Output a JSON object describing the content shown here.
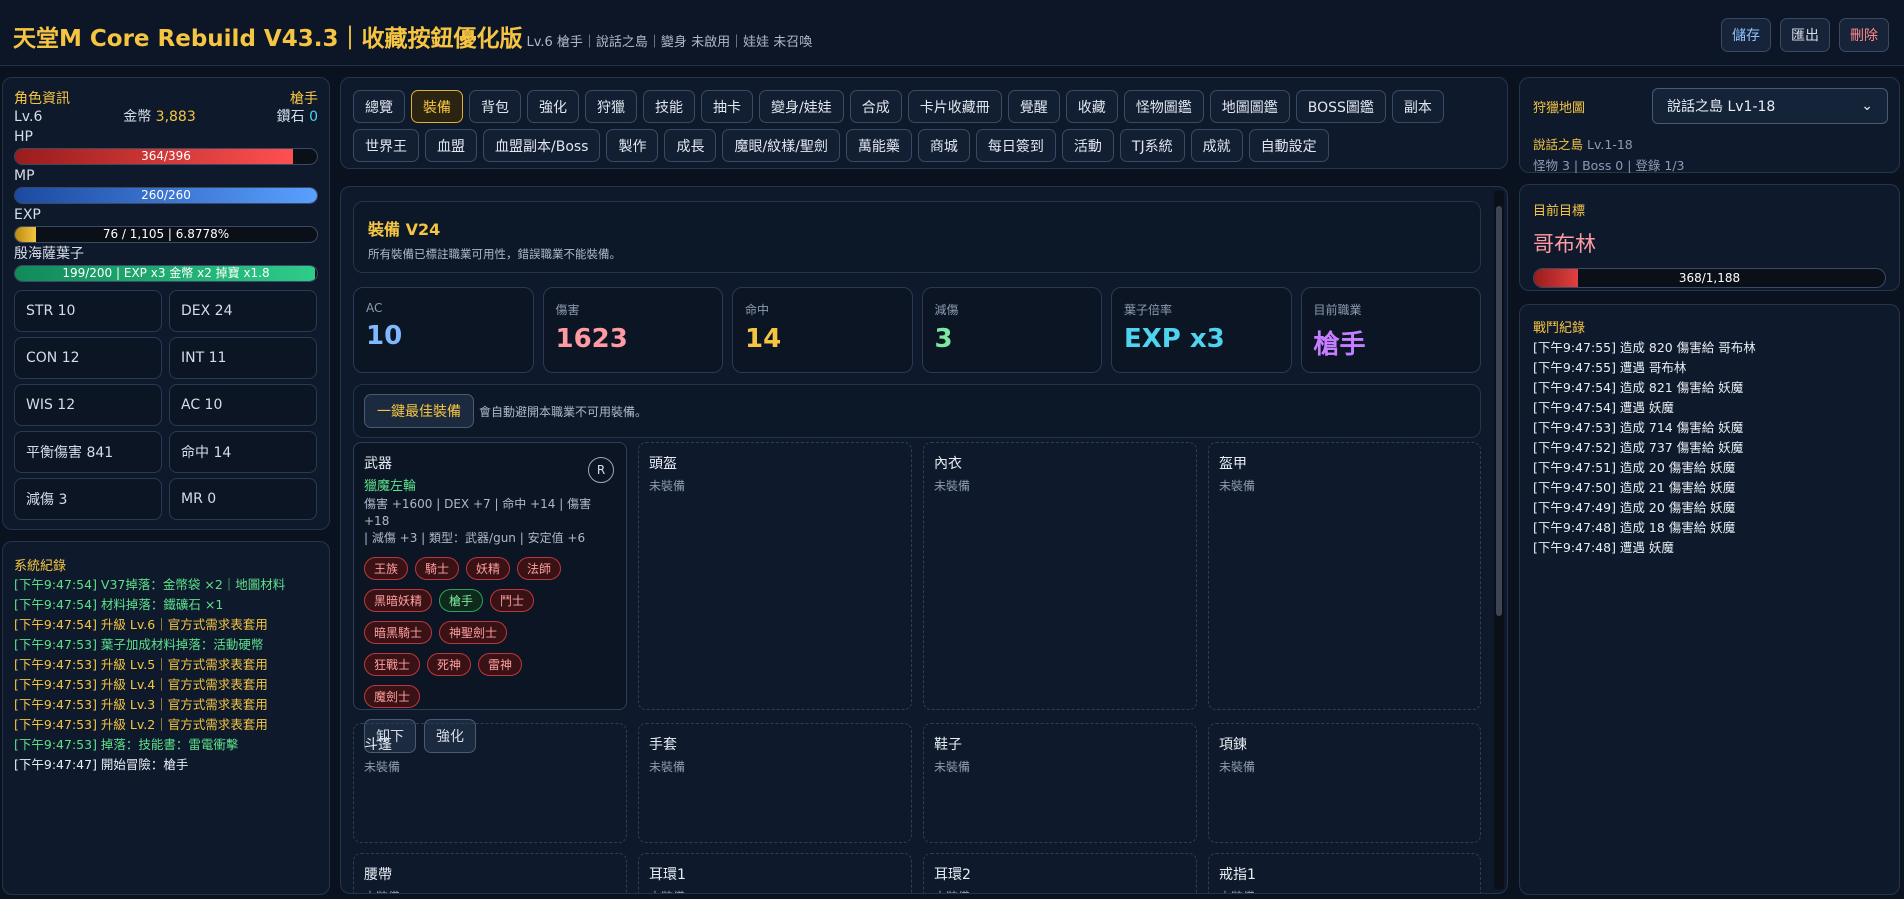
{
  "header": {
    "title": "天堂M Core Rebuild V43.3｜收藏按鈕優化版",
    "subtitle": "Lv.6 槍手｜說話之島｜變身 未啟用｜娃娃 未召喚",
    "buttons": {
      "save": "儲存",
      "export": "匯出",
      "delete": "刪除"
    }
  },
  "character": {
    "heading": "角色資訊",
    "class": "槍手",
    "level": "Lv.6",
    "gold_label": "金幣",
    "gold": "3,883",
    "diamond_label": "鑽石",
    "diamond": "0",
    "hp_label": "HP",
    "hp_text": "364/396",
    "hp_ratio": 0.919,
    "mp_label": "MP",
    "mp_text": "260/260",
    "mp_ratio": 1.0,
    "exp_label": "EXP",
    "exp_text": "76 / 1,105 | 6.8778%",
    "exp_ratio": 0.069,
    "buff_label": "殷海薩葉子",
    "buff_text": "199/200 | EXP x3 金幣 x2 掉寶 x1.8",
    "buff_ratio": 0.995,
    "stats": [
      "STR 10",
      "DEX 24",
      "CON 12",
      "INT 11",
      "WIS 12",
      "AC 10",
      "平衡傷害 841",
      "命中 14",
      "減傷 3",
      "MR 0"
    ]
  },
  "system_log": {
    "heading": "系統紀錄",
    "entries": [
      {
        "text": "[下午9:47:54] V37掉落：金幣袋 ×2｜地圖材料",
        "kind": "g"
      },
      {
        "text": "[下午9:47:54] 材料掉落：鐵礦石 ×1",
        "kind": "g"
      },
      {
        "text": "[下午9:47:54] 升級 Lv.6｜官方式需求表套用",
        "kind": "o"
      },
      {
        "text": "[下午9:47:53] 葉子加成材料掉落：活動硬幣",
        "kind": "g"
      },
      {
        "text": "[下午9:47:53] 升級 Lv.5｜官方式需求表套用",
        "kind": "o"
      },
      {
        "text": "[下午9:47:53] 升級 Lv.4｜官方式需求表套用",
        "kind": "o"
      },
      {
        "text": "[下午9:47:53] 升級 Lv.3｜官方式需求表套用",
        "kind": "o"
      },
      {
        "text": "[下午9:47:53] 升級 Lv.2｜官方式需求表套用",
        "kind": "o"
      },
      {
        "text": "[下午9:47:53] 掉落：技能書：雷電衝擊",
        "kind": "g"
      },
      {
        "text": "[下午9:47:47] 開始冒險：槍手",
        "kind": "w"
      }
    ]
  },
  "tabs": {
    "row1": [
      "總覽",
      "裝備",
      "背包",
      "強化",
      "狩獵",
      "技能",
      "抽卡",
      "變身/娃娃",
      "合成",
      "卡片收藏冊",
      "覺醒",
      "收藏",
      "怪物圖鑑",
      "地圖圖鑑",
      "BOSS圖鑑",
      "副本",
      "世界王"
    ],
    "row2": [
      "血盟",
      "血盟副本/Boss",
      "製作",
      "成長",
      "魔眼/紋樣/聖劍",
      "萬能藥",
      "商城",
      "每日簽到",
      "活動",
      "TJ系統",
      "成就",
      "自動設定"
    ],
    "active": "裝備"
  },
  "equipment": {
    "title": "裝備 V24",
    "desc": "所有裝備已標註職業可用性，錯誤職業不能裝備。",
    "cards": [
      {
        "label": "AC",
        "value": "10",
        "color": "#7fb8ff"
      },
      {
        "label": "傷害",
        "value": "1623",
        "color": "#ff9aa2"
      },
      {
        "label": "命中",
        "value": "14",
        "color": "#f5c542"
      },
      {
        "label": "減傷",
        "value": "3",
        "color": "#7de8a0"
      },
      {
        "label": "葉子倍率",
        "value": "EXP x3",
        "color": "#4fd4f0"
      },
      {
        "label": "目前職業",
        "value": "槍手",
        "color": "#c77dff"
      }
    ],
    "best_button": "一鍵最佳裝備",
    "best_hint": "會自動避開本職業不可用裝備。",
    "weapon": {
      "slot": "武器",
      "name": "獵魔左輪",
      "stats_line1": "傷害 +1600 | DEX +7 | 命中 +14 | 傷害 +18",
      "stats_line2": "| 減傷 +3 | 類型：武器/gun | 安定值 +6",
      "badge": "R",
      "classes": [
        {
          "name": "王族",
          "ok": false
        },
        {
          "name": "騎士",
          "ok": false
        },
        {
          "name": "妖精",
          "ok": false
        },
        {
          "name": "法師",
          "ok": false
        },
        {
          "name": "黑暗妖精",
          "ok": false
        },
        {
          "name": "槍手",
          "ok": true
        },
        {
          "name": "鬥士",
          "ok": false
        },
        {
          "name": "暗黑騎士",
          "ok": false
        },
        {
          "name": "神聖劍士",
          "ok": false
        },
        {
          "name": "狂戰士",
          "ok": false
        },
        {
          "name": "死神",
          "ok": false
        },
        {
          "name": "雷神",
          "ok": false
        },
        {
          "name": "魔劍士",
          "ok": false
        }
      ],
      "unequip": "卸下",
      "enhance": "強化"
    },
    "empty_text": "未裝備",
    "slots": [
      "頭盔",
      "內衣",
      "盔甲",
      "斗篷",
      "手套",
      "鞋子",
      "項鍊",
      "腰帶",
      "耳環1",
      "耳環2",
      "戒指1"
    ]
  },
  "hunt": {
    "heading": "狩獵地圖",
    "select": "說話之島 Lv1-18",
    "map_name": "說話之島",
    "map_level": "Lv.1-18",
    "info": "怪物 3 | Boss 0 | 登錄 1/3"
  },
  "target": {
    "heading": "目前目標",
    "name": "哥布林",
    "hp_text": "368/1,188",
    "hp_ratio": 0.125
  },
  "battle_log": {
    "heading": "戰鬥紀錄",
    "entries": [
      "[下午9:47:55] 造成 820 傷害給 哥布林",
      "[下午9:47:55] 遭遇 哥布林",
      "[下午9:47:54] 造成 821 傷害給 妖魔",
      "[下午9:47:54] 遭遇 妖魔",
      "[下午9:47:53] 造成 714 傷害給 妖魔",
      "[下午9:47:52] 造成 737 傷害給 妖魔",
      "[下午9:47:51] 造成 20 傷害給 妖魔",
      "[下午9:47:50] 造成 21 傷害給 妖魔",
      "[下午9:47:49] 造成 20 傷害給 妖魔",
      "[下午9:47:48] 造成 18 傷害給 妖魔",
      "[下午9:47:48] 遭遇 妖魔"
    ]
  }
}
